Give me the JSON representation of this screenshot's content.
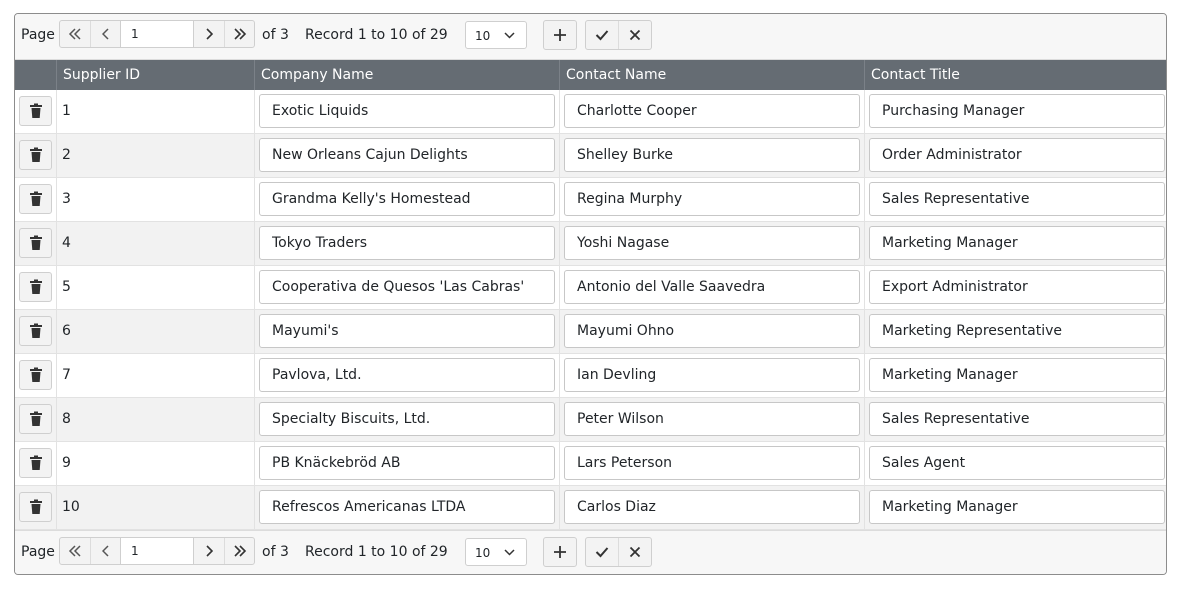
{
  "pager_top": {
    "page_label": "Page",
    "page_value": "1",
    "of_label": "of 3",
    "record_label": "Record 1 to 10 of 29",
    "page_size": "10"
  },
  "pager_bottom": {
    "page_label": "Page",
    "page_value": "1",
    "of_label": "of 3",
    "record_label": "Record 1 to 10 of 29",
    "page_size": "10"
  },
  "icons": {
    "first": "double-chevron-left-icon",
    "prev": "chevron-left-icon",
    "next": "chevron-right-icon",
    "last": "double-chevron-right-icon",
    "add": "plus-icon",
    "save": "check-icon",
    "cancel": "x-icon",
    "delete": "trash-icon"
  },
  "columns": [
    "Supplier ID",
    "Company Name",
    "Contact Name",
    "Contact Title"
  ],
  "rows": [
    {
      "id": "1",
      "company": "Exotic Liquids",
      "contact": "Charlotte Cooper",
      "title": "Purchasing Manager"
    },
    {
      "id": "2",
      "company": "New Orleans Cajun Delights",
      "contact": "Shelley Burke",
      "title": "Order Administrator"
    },
    {
      "id": "3",
      "company": "Grandma Kelly's Homestead",
      "contact": "Regina Murphy",
      "title": "Sales Representative"
    },
    {
      "id": "4",
      "company": "Tokyo Traders",
      "contact": "Yoshi Nagase",
      "title": "Marketing Manager"
    },
    {
      "id": "5",
      "company": "Cooperativa de Quesos 'Las Cabras'",
      "contact": "Antonio del Valle Saavedra",
      "title": "Export Administrator"
    },
    {
      "id": "6",
      "company": "Mayumi's",
      "contact": "Mayumi Ohno",
      "title": "Marketing Representative"
    },
    {
      "id": "7",
      "company": "Pavlova, Ltd.",
      "contact": "Ian Devling",
      "title": "Marketing Manager"
    },
    {
      "id": "8",
      "company": "Specialty Biscuits, Ltd.",
      "contact": "Peter Wilson",
      "title": "Sales Representative"
    },
    {
      "id": "9",
      "company": "PB Knäckebröd AB",
      "contact": "Lars Peterson",
      "title": "Sales Agent"
    },
    {
      "id": "10",
      "company": "Refrescos Americanas LTDA",
      "contact": "Carlos Diaz",
      "title": "Marketing Manager"
    }
  ],
  "colors": {
    "header_bg": "#656c73",
    "alt_row_bg": "#f2f2f2",
    "pager_bg": "#f7f7f7"
  }
}
